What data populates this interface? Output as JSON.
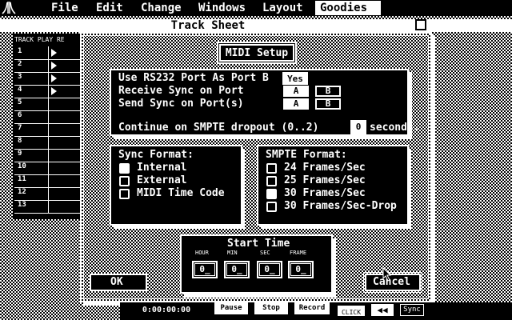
{
  "menubar": {
    "items": [
      "File",
      "Edit",
      "Change",
      "Windows",
      "Layout",
      "Goodies"
    ],
    "active": "Goodies"
  },
  "track_sheet": {
    "title": "Track Sheet",
    "header": "TRACK PLAY RE",
    "tracks": [
      "1",
      "2",
      "3",
      "4",
      "5",
      "6",
      "7",
      "8",
      "9",
      "10",
      "11",
      "12",
      "13"
    ],
    "play_marked": [
      true,
      true,
      true,
      true,
      false,
      false,
      false,
      false,
      false,
      false,
      false,
      false,
      false
    ]
  },
  "dialog": {
    "title": "MIDI Setup",
    "ports": {
      "rs232_label": "Use RS232 Port As Port B",
      "rs232_value": "Yes",
      "receive_label": "Receive Sync on Port",
      "send_label": "Send Sync on Port(s)",
      "port_a": "A",
      "port_b": "B",
      "dropout_label": "Continue on SMPTE dropout (0..2)",
      "dropout_value": "0",
      "dropout_unit": "seconds."
    },
    "sync_format": {
      "title": "Sync Format:",
      "options": [
        "Internal",
        "External",
        "MIDI Time Code"
      ],
      "selected": 0
    },
    "smpte_format": {
      "title": "SMPTE Format:",
      "options": [
        "24 Frames/Sec",
        "25 Frames/Sec",
        "30 Frames/Sec",
        "30 Frames/Sec-Drop"
      ],
      "selected": 2
    },
    "start_time": {
      "title": "Start Time",
      "labels": [
        "HOUR",
        "MIN",
        "SEC",
        "FRAME"
      ],
      "values": [
        "0_",
        "0_",
        "0_",
        "0_"
      ]
    },
    "ok_label": "OK",
    "cancel_label": "Cancel"
  },
  "transport": {
    "time": "0:00:00:00",
    "pause": "Pause",
    "stop": "Stop",
    "record": "Record",
    "click": "CLICK",
    "rewind": "◀◀",
    "sync": "Sync"
  }
}
